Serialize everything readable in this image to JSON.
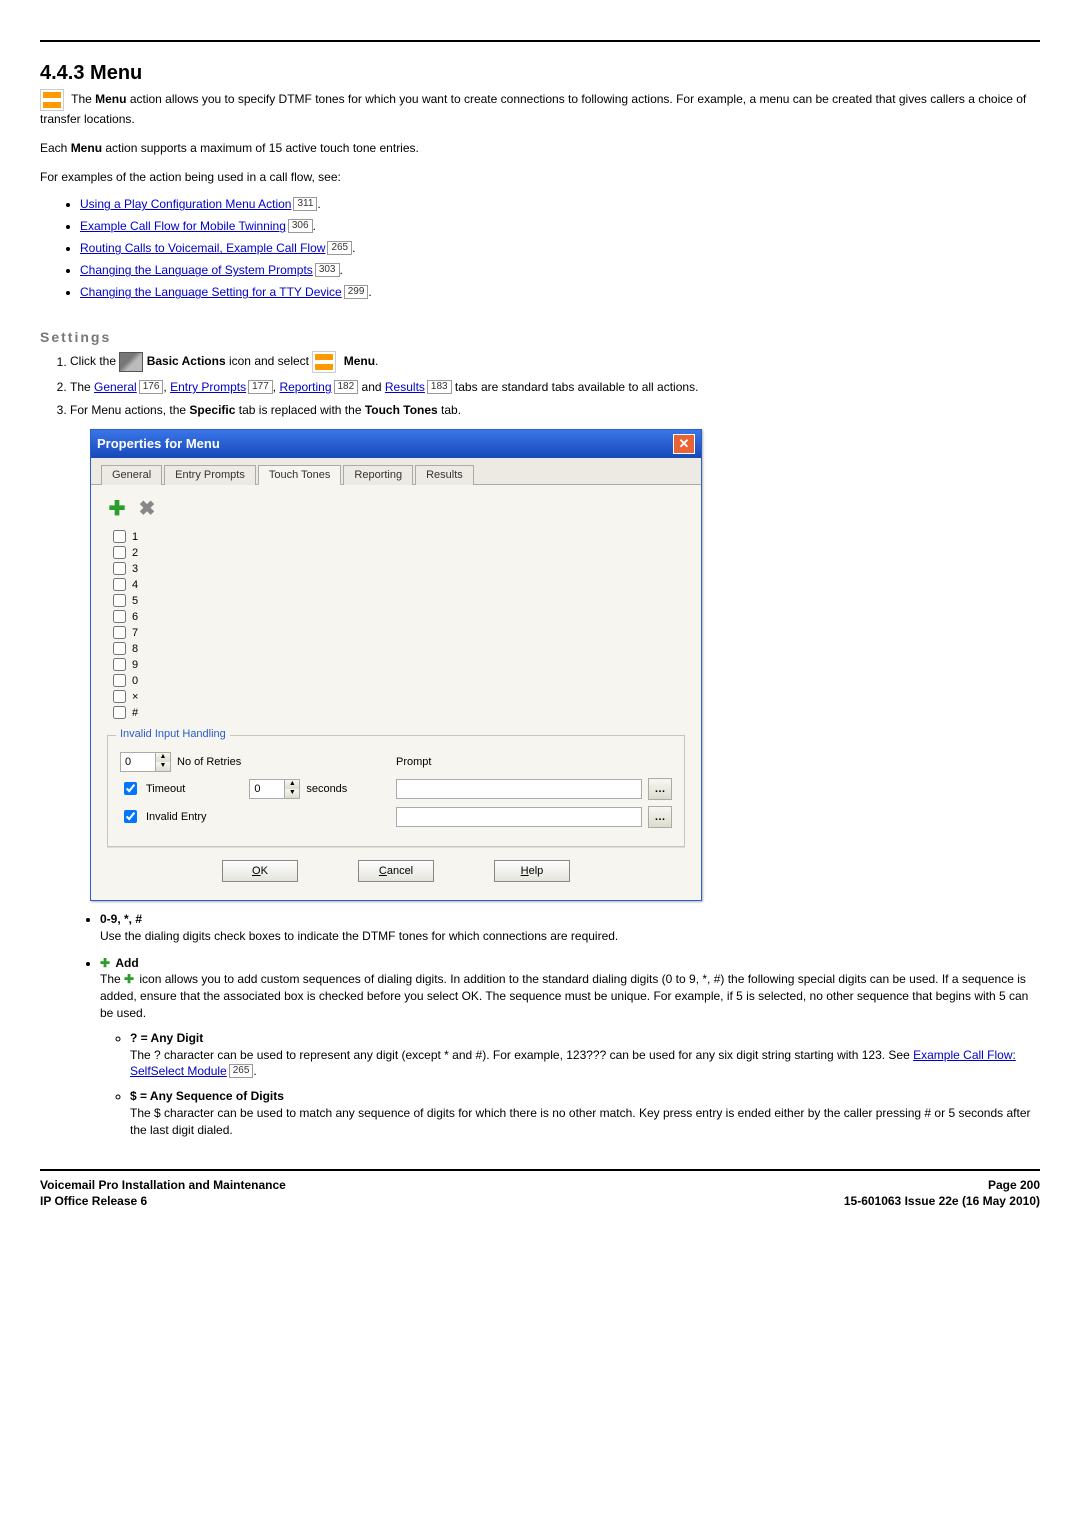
{
  "section_title": "4.4.3 Menu",
  "intro": {
    "p1_a": "The ",
    "p1_b": "Menu",
    "p1_c": " action allows you to specify DTMF tones for which you want to create connections to following actions. For example, a menu can be created that gives callers a choice of transfer locations.",
    "p2_a": "Each ",
    "p2_b": "Menu",
    "p2_c": " action supports a maximum of 15 active touch tone entries.",
    "p3": "For examples of the action being used in a call flow, see:"
  },
  "links": [
    {
      "text": "Using a Play Configuration Menu Action",
      "ref": "311"
    },
    {
      "text": "Example Call Flow for Mobile Twinning",
      "ref": "306"
    },
    {
      "text": "Routing Calls to Voicemail, Example Call Flow",
      "ref": "265"
    },
    {
      "text": "Changing the Language of System Prompts",
      "ref": "303"
    },
    {
      "text": "Changing the Language Setting for a TTY Device",
      "ref": "299"
    }
  ],
  "settings_heading": "Settings",
  "settings_steps": {
    "s1_a": "Click the ",
    "s1_b": " Basic Actions",
    "s1_c": " icon and select ",
    "s1_d": " Menu",
    "s1_e": ".",
    "s2_a": "The ",
    "s2_tabs": [
      {
        "text": "General",
        "ref": "176"
      },
      {
        "text": "Entry Prompts",
        "ref": "177"
      },
      {
        "text": "Reporting",
        "ref": "182"
      },
      {
        "text": "Results",
        "ref": "183"
      }
    ],
    "s2_mid_and": " and ",
    "s2_b": " tabs are standard tabs available to all actions.",
    "s3_a": "For Menu actions, the ",
    "s3_b": "Specific",
    "s3_c": " tab is replaced with the ",
    "s3_d": "Touch Tones",
    "s3_e": " tab."
  },
  "dialog": {
    "title": "Properties for Menu",
    "tabs": [
      "General",
      "Entry Prompts",
      "Touch Tones",
      "Reporting",
      "Results"
    ],
    "active_tab_index": 2,
    "digits": [
      "1",
      "2",
      "3",
      "4",
      "5",
      "6",
      "7",
      "8",
      "9",
      "0",
      "×",
      "#"
    ],
    "group_title": "Invalid Input Handling",
    "retries": {
      "value": "0",
      "label": "No of Retries"
    },
    "prompt_label": "Prompt",
    "timeout": {
      "checked": true,
      "label": "Timeout",
      "value": "0",
      "unit": "seconds"
    },
    "invalid": {
      "checked": true,
      "label": "Invalid Entry"
    },
    "buttons": {
      "ok": "OK",
      "cancel": "Cancel",
      "help": "Help"
    }
  },
  "details": {
    "digits_title": "0-9, *, #",
    "digits_text": "Use the dialing digits check boxes to indicate the DTMF tones for which connections are required.",
    "add_title": "Add",
    "add_text_a": "The ",
    "add_text_b": " icon allows you to add custom sequences of dialing digits. In addition to the standard dialing digits (0 to 9, *, #) the following special digits can be used. If a sequence is added, ensure that the associated box is checked before you select OK. The sequence must be unique. For example, if 5 is selected, no other sequence that begins with 5 can be used.",
    "q_title": "? = Any Digit",
    "q_text_a": "The ? character can be used to represent any digit (except * and #). For example, 123??? can be used for any six digit string starting with 123. See ",
    "q_link": "Example Call Flow: SelfSelect Module",
    "q_ref": "265",
    "q_text_b": ".",
    "s_title": "$ = Any Sequence of Digits",
    "s_text": "The $ character can be used to match any sequence of digits for which there is no other match. Key press entry is ended either by the caller pressing # or 5 seconds after the last digit dialed."
  },
  "footer": {
    "left1": "Voicemail Pro Installation and Maintenance",
    "left2": "IP Office Release 6",
    "right1": "Page 200",
    "right2": "15-601063 Issue 22e (16 May 2010)"
  }
}
